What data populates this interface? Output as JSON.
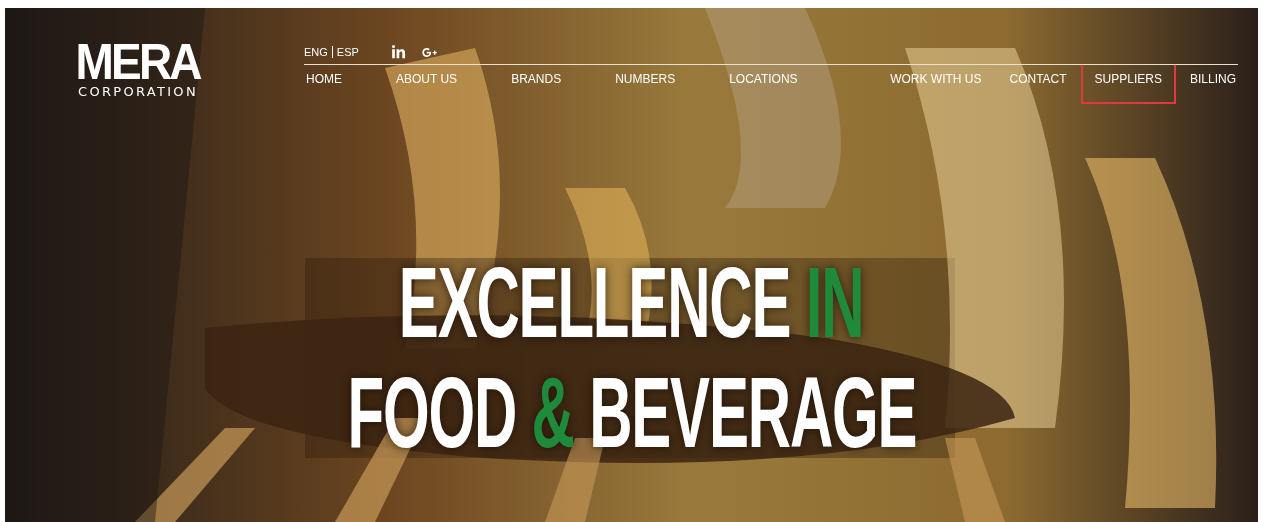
{
  "logo": {
    "name": "MERA",
    "subtitle": "CORPORATION"
  },
  "languages": [
    {
      "label": "ENG"
    },
    {
      "label": "ESP"
    }
  ],
  "nav_left": [
    {
      "label": "HOME",
      "highlighted": false
    },
    {
      "label": "ABOUT US",
      "highlighted": false
    },
    {
      "label": "BRANDS",
      "highlighted": false
    },
    {
      "label": "NUMBERS",
      "highlighted": false
    },
    {
      "label": "LOCATIONS",
      "highlighted": false
    }
  ],
  "nav_right": [
    {
      "label": "WORK WITH US",
      "highlighted": false
    },
    {
      "label": "CONTACT",
      "highlighted": false
    },
    {
      "label": "SUPPLIERS",
      "highlighted": true
    },
    {
      "label": "BILLING",
      "highlighted": false
    }
  ],
  "hero": {
    "kind": "picture",
    "headline": [
      [
        {
          "text": "EXCELLENCE ",
          "accent": false
        },
        {
          "text": "IN",
          "accent": true
        }
      ],
      [
        {
          "text": "FOOD ",
          "accent": false
        },
        {
          "text": "&",
          "accent": true
        },
        {
          "text": " BEVERAGE",
          "accent": false
        }
      ]
    ]
  }
}
